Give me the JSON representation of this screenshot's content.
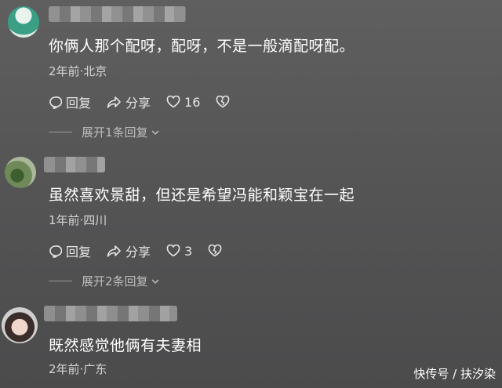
{
  "comments": [
    {
      "text": "你俩人那个配呀，配呀，不是一般滴配呀配。",
      "meta": "2年前·北京",
      "reply_label": "回复",
      "share_label": "分享",
      "like_count": "16",
      "expand_label": "展开1条回复"
    },
    {
      "text": "虽然喜欢景甜，但还是希望冯能和颖宝在一起",
      "meta": "1年前·四川",
      "reply_label": "回复",
      "share_label": "分享",
      "like_count": "3",
      "expand_label": "展开2条回复"
    },
    {
      "text": "既然感觉他俩有夫妻相",
      "meta": "2年前·广东"
    }
  ],
  "watermark": "快传号 / 扶汐染",
  "icons": [
    "reply-icon",
    "share-icon",
    "heart-icon",
    "broken-heart-icon",
    "chevron-down-icon"
  ]
}
